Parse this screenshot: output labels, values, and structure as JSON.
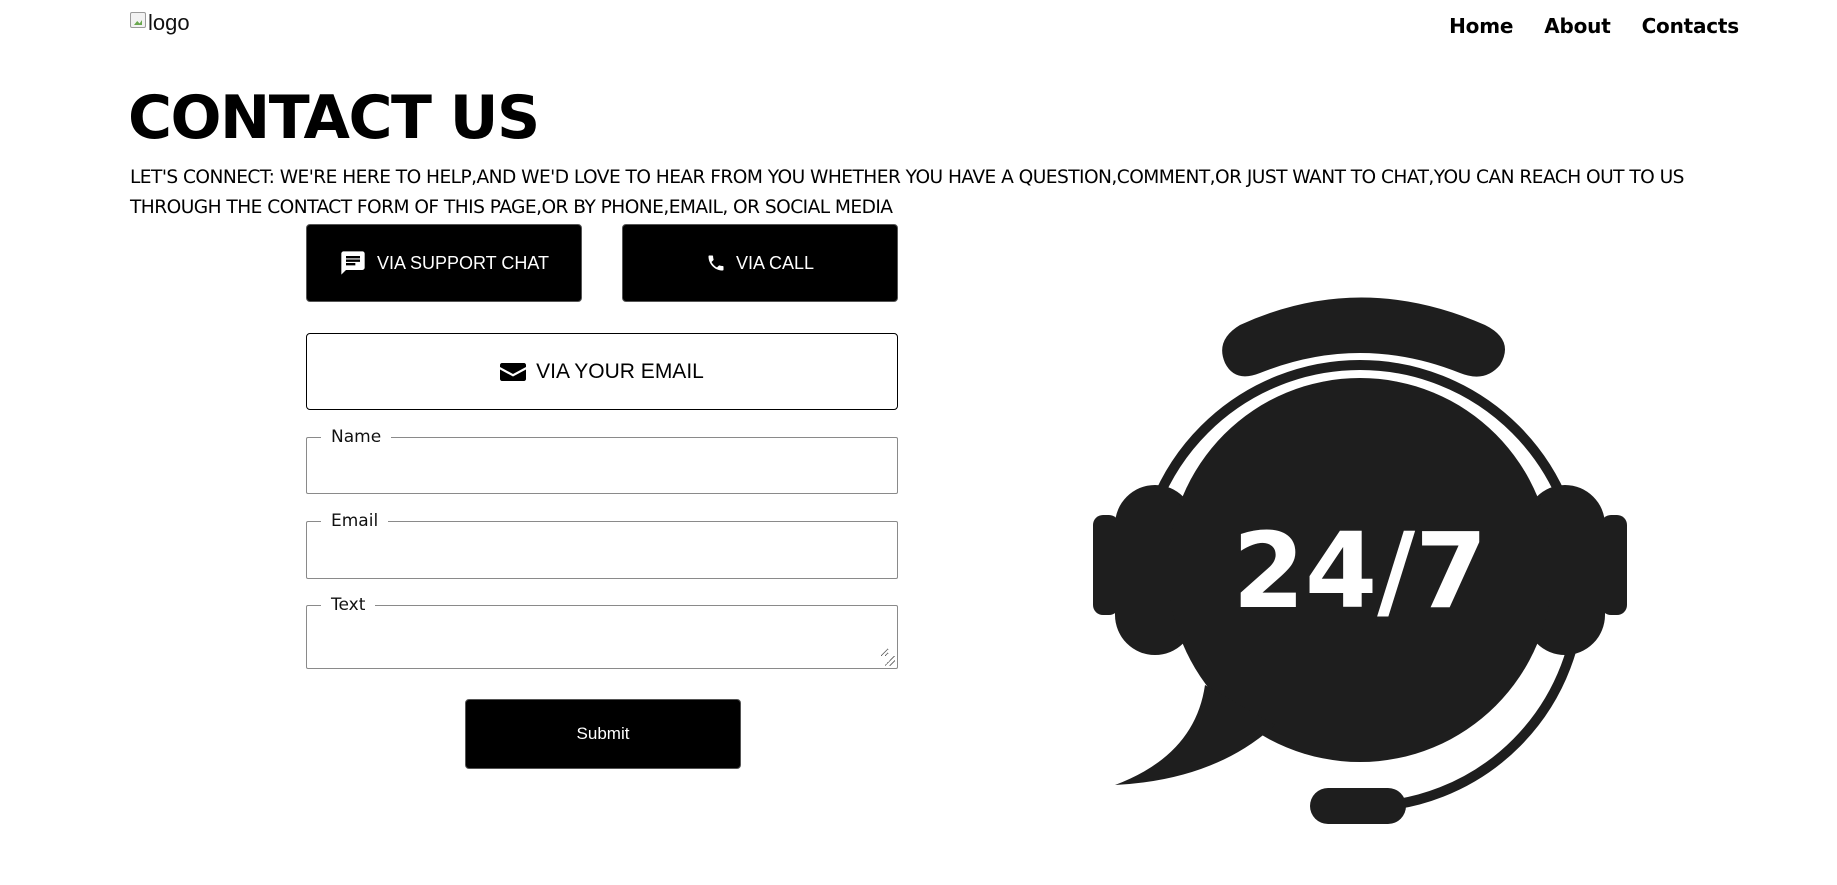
{
  "header": {
    "logo_alt": "logo",
    "nav": [
      "Home",
      "About",
      "Contacts"
    ]
  },
  "main": {
    "title": "CONTACT US",
    "intro": "LET'S CONNECT: WE'RE HERE TO HELP,AND WE'D LOVE TO HEAR FROM YOU WHETHER YOU HAVE A QUESTION,COMMENT,OR JUST WANT TO CHAT,YOU CAN REACH OUT TO US THROUGH THE CONTACT FORM OF THIS PAGE,OR BY PHONE,EMAIL, OR SOCIAL MEDIA"
  },
  "buttons": {
    "chat": "VIA SUPPORT CHAT",
    "call": "VIA CALL",
    "email": "VIA YOUR EMAIL",
    "submit": "Submit"
  },
  "form": {
    "name_label": "Name",
    "name_value": "",
    "email_label": "Email",
    "email_value": "",
    "text_label": "Text",
    "text_value": ""
  },
  "illustration": {
    "text": "24/7",
    "icon": "headset-support-icon"
  },
  "icons": {
    "chat": "chat-bubble-icon",
    "call": "phone-icon",
    "email": "envelope-icon"
  },
  "colors": {
    "primary": "#000000",
    "illustration": "#1e1e1e",
    "background": "#ffffff"
  }
}
